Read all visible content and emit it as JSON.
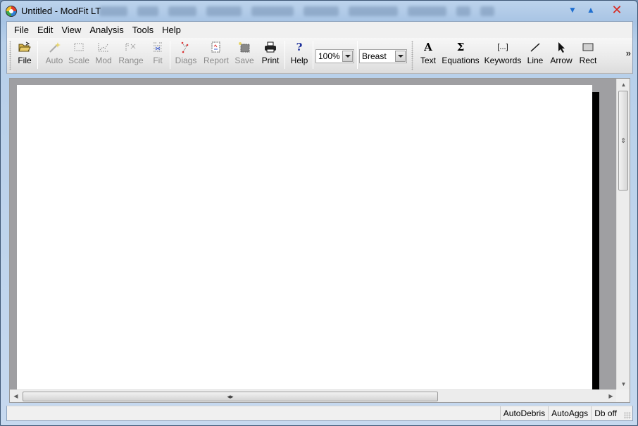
{
  "window": {
    "title": "Untitled - ModFit LT",
    "controls": [
      "minimize",
      "maximize",
      "close"
    ]
  },
  "menu": {
    "items": [
      "File",
      "Edit",
      "View",
      "Analysis",
      "Tools",
      "Help"
    ]
  },
  "toolbar": {
    "buttons": [
      {
        "label": "File",
        "icon": "folder-open-icon",
        "enabled": true
      },
      {
        "label": "Auto",
        "icon": "magic-wand-icon",
        "enabled": false
      },
      {
        "label": "Scale",
        "icon": "scale-icon",
        "enabled": false
      },
      {
        "label": "Mod",
        "icon": "model-icon",
        "enabled": false
      },
      {
        "label": "Range",
        "icon": "range-icon",
        "enabled": false
      },
      {
        "label": "Fit",
        "icon": "fit-icon",
        "enabled": false
      },
      {
        "label": "Diags",
        "icon": "diagnostics-icon",
        "enabled": false
      },
      {
        "label": "Report",
        "icon": "report-icon",
        "enabled": false
      },
      {
        "label": "Save",
        "icon": "save-icon",
        "enabled": false
      },
      {
        "label": "Print",
        "icon": "printer-icon",
        "enabled": true
      },
      {
        "label": "Help",
        "icon": "help-icon",
        "enabled": true
      }
    ],
    "zoom_value": "100%",
    "tissue_value": "Breast",
    "drawing_tools": [
      {
        "label": "Text",
        "icon": "text-icon",
        "glyph": "A"
      },
      {
        "label": "Equations",
        "icon": "sigma-icon",
        "glyph": "Σ"
      },
      {
        "label": "Keywords",
        "icon": "keywords-icon",
        "glyph": "[...]"
      },
      {
        "label": "Line",
        "icon": "line-icon",
        "glyph": "/"
      },
      {
        "label": "Arrow",
        "icon": "arrow-pointer-icon",
        "glyph": "➤"
      },
      {
        "label": "Rect",
        "icon": "rectangle-icon",
        "glyph": "▭"
      }
    ],
    "overflow_glyph": "»"
  },
  "statusbar": {
    "panes": [
      "AutoDebris",
      "AutoAggs",
      "Db off"
    ]
  }
}
